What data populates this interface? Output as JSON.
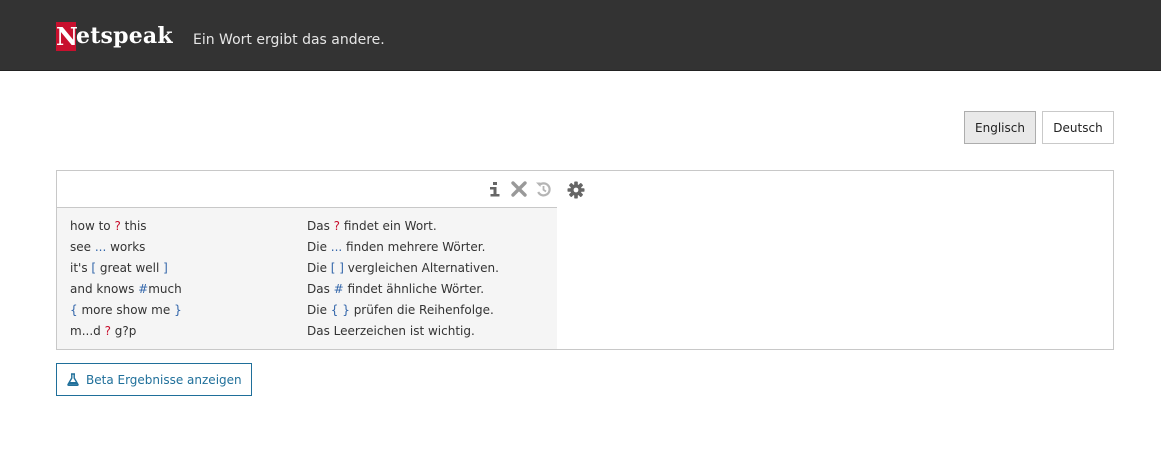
{
  "header": {
    "logo_first": "N",
    "logo_rest": "etspeak",
    "tagline": "Ein Wort ergibt das andere."
  },
  "languages": {
    "english": "Englisch",
    "german": "Deutsch",
    "selected": "Englisch"
  },
  "search": {
    "value": "",
    "placeholder": ""
  },
  "examples": [
    {
      "q": [
        "how to ",
        "?",
        " this"
      ],
      "d": [
        "Das ",
        "?",
        " findet ein Wort."
      ]
    },
    {
      "q": [
        "see ",
        "...",
        " works"
      ],
      "d": [
        "Die ",
        "...",
        " finden mehrere Wörter."
      ]
    },
    {
      "q": [
        "it's ",
        "[",
        " great well ",
        "]"
      ],
      "d": [
        "Die ",
        "[ ]",
        " vergleichen Alternativen."
      ]
    },
    {
      "q": [
        "and knows ",
        "#",
        "much"
      ],
      "d": [
        "Das ",
        "#",
        " findet ähnliche Wörter."
      ]
    },
    {
      "q": [
        "",
        "{",
        " more show me ",
        "}"
      ],
      "d": [
        "Die ",
        "{ }",
        " prüfen die Reihenfolge."
      ]
    },
    {
      "q": [
        "m...d ",
        "?",
        " g?p"
      ],
      "d": [
        "Das Leerzeichen ist wichtig."
      ]
    }
  ],
  "beta_button": "Beta Ergebnisse anzeigen",
  "icons": {
    "info": "info-icon",
    "clear": "close-icon",
    "history": "history-icon",
    "settings": "gear-icon",
    "beta": "flask-icon"
  },
  "colors": {
    "header_bg": "#333333",
    "brand_red": "#c8102e",
    "wildcard_blue": "#3366aa",
    "beta_blue": "#1f6f9a"
  }
}
